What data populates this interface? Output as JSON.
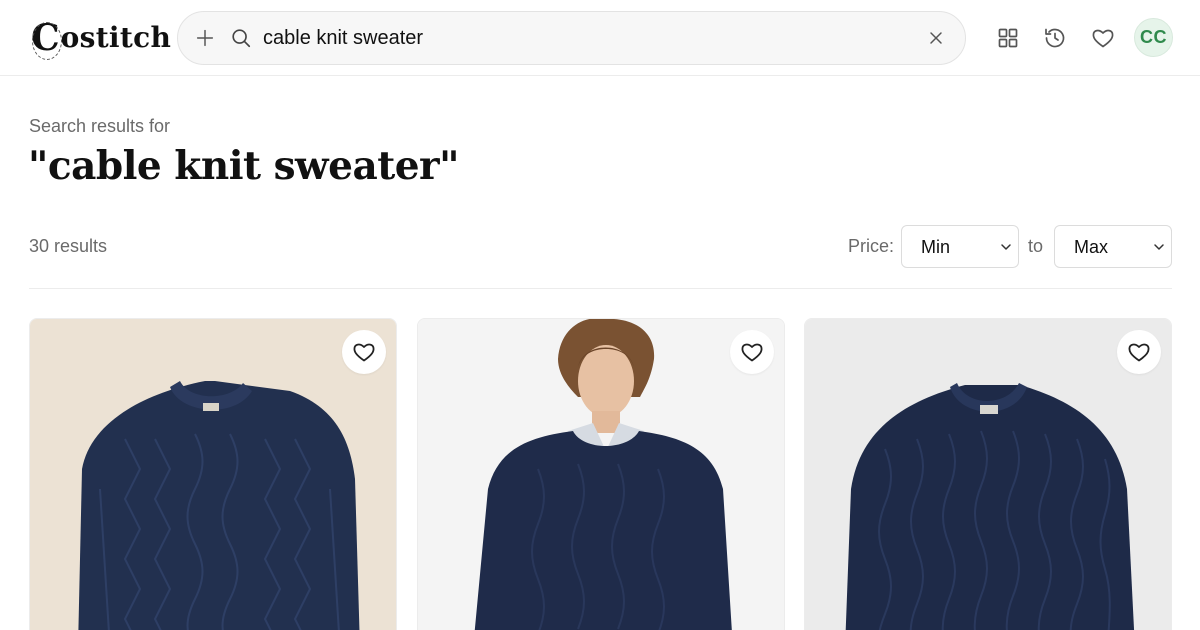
{
  "app": {
    "brand_initial": "C",
    "brand_rest": "ostitch"
  },
  "search": {
    "query": "cable knit sweater",
    "placeholder": "Search"
  },
  "header": {
    "avatar_initials": "CC",
    "icons": [
      "plus-icon",
      "search-icon",
      "close-icon",
      "grid-icon",
      "history-icon",
      "heart-icon"
    ]
  },
  "results": {
    "subheading": "Search results for",
    "title": "\"cable knit sweater\"",
    "count_label": "30 results"
  },
  "filters": {
    "price_label": "Price:",
    "min_value": "Min",
    "to_label": "to",
    "max_value": "Max"
  },
  "colors": {
    "accent_green": "#2f8a4c",
    "avatar_bg": "#e6f4ea",
    "navy_sweater": "#1f2b4a"
  },
  "products": [
    {
      "image": "navy-aran-cable-sweater-flat",
      "background": "#ece2d4"
    },
    {
      "image": "model-wearing-navy-cable-sweater",
      "background": "#f4f4f4"
    },
    {
      "image": "navy-cable-knit-sweater-flat",
      "background": "#ebebeb"
    }
  ]
}
